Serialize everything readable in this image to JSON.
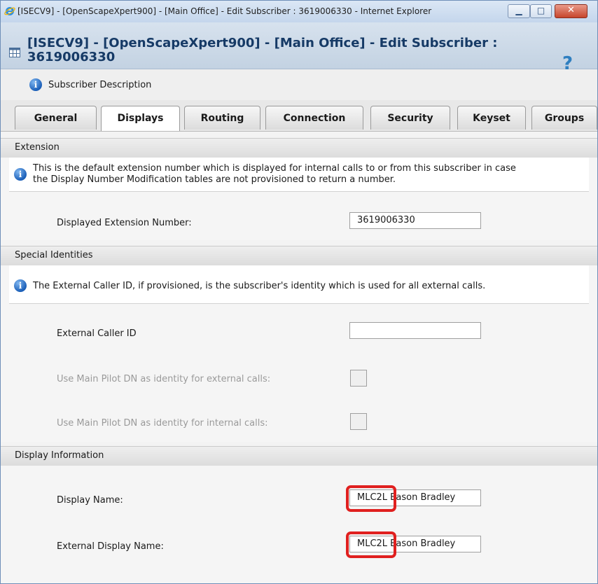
{
  "window": {
    "title": "[ISECV9] - [OpenScapeXpert900] - [Main Office] - Edit Subscriber : 3619006330 - Internet Explorer",
    "minimize_glyph": "▁",
    "maximize_glyph": "□",
    "close_glyph": "✕"
  },
  "dialog": {
    "title": "[ISECV9] - [OpenScapeXpert900] - [Main Office] - Edit Subscriber : 3619006330",
    "help_glyph": "?",
    "description_label": "Subscriber Description"
  },
  "tabs": [
    {
      "label": "General",
      "active": false
    },
    {
      "label": "Displays",
      "active": true
    },
    {
      "label": "Routing",
      "active": false
    },
    {
      "label": "Connection",
      "active": false
    },
    {
      "label": "Security",
      "active": false
    },
    {
      "label": "Keyset",
      "active": false
    },
    {
      "label": "Groups",
      "active": false
    }
  ],
  "extension": {
    "heading": "Extension",
    "info_line1": "This is the default extension number which is displayed for internal calls to or from this subscriber in case",
    "info_line2": "the Display Number Modification tables are not provisioned to return a number.",
    "displayed_extension_label": "Displayed Extension Number:",
    "displayed_extension_value": "3619006330"
  },
  "special_identities": {
    "heading": "Special Identities",
    "info": "The External Caller ID, if provisioned, is the subscriber's identity which is used for all external calls.",
    "external_caller_id_label": "External Caller ID",
    "external_caller_id_value": "",
    "main_pilot_external_label": "Use Main Pilot DN as identity for external calls:",
    "main_pilot_internal_label": "Use Main Pilot DN as identity for internal calls:"
  },
  "display_information": {
    "heading": "Display Information",
    "display_name_label": "Display Name:",
    "display_name_value": "MLC2L Eason Bradley",
    "external_display_name_label": "External Display Name:",
    "external_display_name_value": "MLC2L Eason Bradley"
  },
  "colors": {
    "highlight": "#e0201f",
    "title_text": "#163a66",
    "info_icon": "#1b5fb8"
  },
  "icons": {
    "browser": "internet-explorer-icon",
    "dialog": "grid-icon",
    "help": "help-icon",
    "info": "info-icon"
  }
}
